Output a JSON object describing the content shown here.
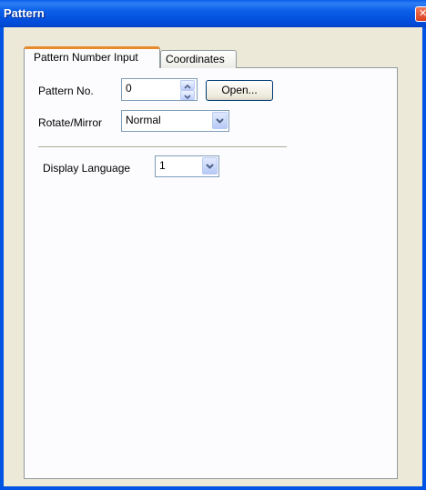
{
  "window": {
    "title": "Pattern",
    "close_icon": "close-icon"
  },
  "tabs": [
    {
      "label": "Pattern Number Input",
      "active": true
    },
    {
      "label": "Coordinates",
      "active": false
    }
  ],
  "form": {
    "pattern_no_label": "Pattern No.",
    "pattern_no_value": "0",
    "open_button": "Open...",
    "rotate_mirror_label": "Rotate/Mirror",
    "rotate_mirror_value": "Normal",
    "display_language_label": "Display Language",
    "display_language_value": "1"
  },
  "colors": {
    "title_bar": "#0054e3",
    "dialog_background": "#ece9d8",
    "active_tab_accent": "#e68b2c",
    "field_border": "#7f9db9"
  }
}
